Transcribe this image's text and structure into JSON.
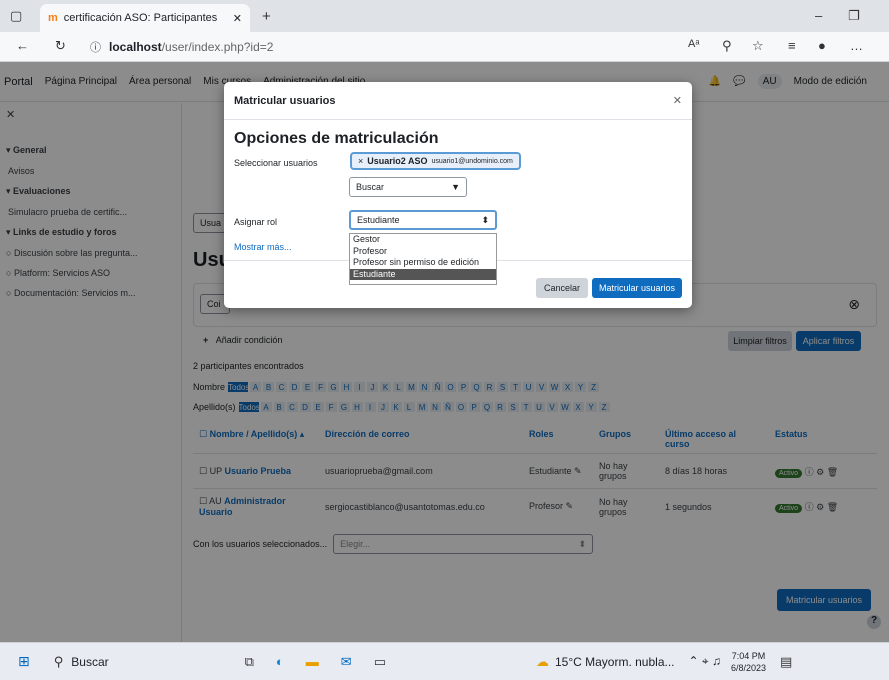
{
  "browser": {
    "tab_title": "certificación ASO: Participantes",
    "url_host": "localhost",
    "url_path": "/user/index.php?id=2"
  },
  "topnav": {
    "brand": "Portal",
    "items": [
      "Página Principal",
      "Área personal",
      "Mis cursos",
      "Administración del sitio"
    ],
    "user_initials": "AU",
    "edit_mode_label": "Modo de edición"
  },
  "drawer": {
    "items": [
      {
        "label": "General",
        "bold": true
      },
      {
        "label": "Avisos",
        "bold": false
      },
      {
        "label": "Evaluaciones",
        "bold": true
      },
      {
        "label": "Simulacro prueba de certific...",
        "bold": false
      },
      {
        "label": "Links de estudio y foros",
        "bold": true
      },
      {
        "label": "Discusión sobre las pregunta...",
        "bold": false
      },
      {
        "label": "Platform: Servicios ASO",
        "bold": false
      },
      {
        "label": "Documentación: Servicios m...",
        "bold": false
      }
    ]
  },
  "content": {
    "heading": "Usu",
    "filter_select": "Usua",
    "filter_cond": "Coi",
    "add_condition": "Añadir condición",
    "clear_filters": "Limpiar filtros",
    "apply_filters": "Aplicar filtros",
    "count_text": "2 participantes encontrados",
    "first_name_label": "Nombre",
    "last_name_label": "Apellido(s)",
    "all_label": "Todos",
    "letters": [
      "A",
      "B",
      "C",
      "D",
      "E",
      "F",
      "G",
      "H",
      "I",
      "J",
      "K",
      "L",
      "M",
      "N",
      "Ñ",
      "O",
      "P",
      "Q",
      "R",
      "S",
      "T",
      "U",
      "V",
      "W",
      "X",
      "Y",
      "Z"
    ],
    "columns": [
      "Nombre / Apellido(s)",
      "Dirección de correo",
      "Roles",
      "Grupos",
      "Último acceso al curso",
      "Estatus"
    ],
    "rows": [
      {
        "initials": "UP",
        "name": "Usuario Prueba",
        "email": "usuarioprueba@gmail.com",
        "role": "Estudiante",
        "groups": "No hay grupos",
        "access": "8 días 18 horas",
        "status": "Activo"
      },
      {
        "initials": "AU",
        "name": "Administrador Usuario",
        "email": "sergiocastiblanco@usantotomas.edu.co",
        "role": "Profesor",
        "groups": "No hay grupos",
        "access": "1 segundos",
        "status": "Activo"
      }
    ],
    "bulk_label": "Con los usuarios seleccionados...",
    "bulk_placeholder": "Elegir...",
    "enrol_button": "Matricular usuarios"
  },
  "modal": {
    "title": "Matricular usuarios",
    "section_title": "Opciones de matriculación",
    "select_users_label": "Seleccionar usuarios",
    "chip_name": "Usuario2 ASO",
    "chip_email": "usuario1@undominio.com",
    "search_placeholder": "Buscar",
    "assign_role_label": "Asignar rol",
    "role_value": "Estudiante",
    "show_more": "Mostrar más...",
    "role_options": [
      "Gestor",
      "Profesor",
      "Profesor sin permiso de edición",
      "Estudiante"
    ],
    "selected_option": "Estudiante",
    "cancel": "Cancelar",
    "submit": "Matricular usuarios"
  },
  "taskbar": {
    "search": "Buscar",
    "weather": "15°C  Mayorm. nubla...",
    "time": "7:04 PM",
    "date": "6/8/2023"
  },
  "colors": {
    "accent": "#0f6cbf",
    "active_badge": "#357a32"
  }
}
